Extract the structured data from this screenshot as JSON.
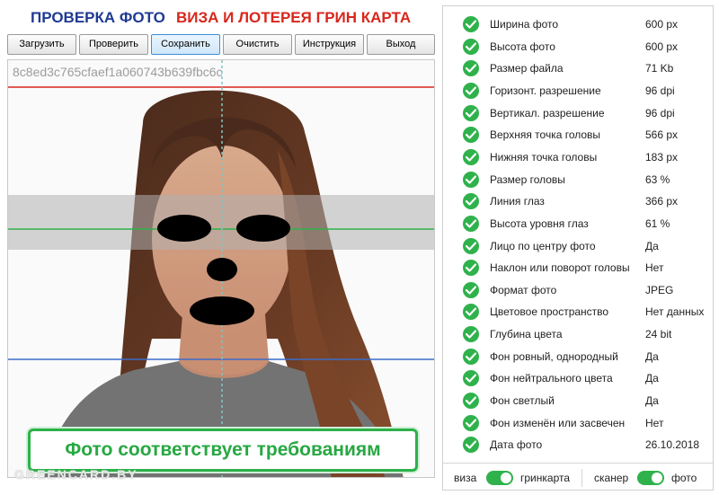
{
  "header": {
    "title_left": "ПРОВЕРКА ФОТО",
    "title_right": "ВИЗА И ЛОТЕРЕЯ ГРИН КАРТА",
    "title_left_color": "#1f3a93",
    "title_right_color": "#d9261c"
  },
  "toolbar": {
    "buttons": [
      "Загрузить",
      "Проверить",
      "Сохранить",
      "Очистить",
      "Инструкция",
      "Выход"
    ],
    "active": "Сохранить"
  },
  "photo": {
    "hash": "8c8ed3c765cfaef1a060743b639fbc6c",
    "status_text": "Фото соответствует требованиям",
    "watermark": "GREENCARD.BY"
  },
  "checks": [
    {
      "label": "Ширина фото",
      "value": "600 px"
    },
    {
      "label": "Высота фото",
      "value": "600 px"
    },
    {
      "label": "Размер файла",
      "value": "71 Kb"
    },
    {
      "label": "Горизонт. разрешение",
      "value": "96 dpi"
    },
    {
      "label": "Вертикал. разрешение",
      "value": "96 dpi"
    },
    {
      "label": "Верхняя точка головы",
      "value": "566 px"
    },
    {
      "label": "Нижняя точка головы",
      "value": "183 px"
    },
    {
      "label": "Размер головы",
      "value": "63 %"
    },
    {
      "label": "Линия глаз",
      "value": "366 px"
    },
    {
      "label": "Высота уровня глаз",
      "value": "61 %"
    },
    {
      "label": "Лицо по центру фото",
      "value": "Да"
    },
    {
      "label": "Наклон или поворот головы",
      "value": "Нет"
    },
    {
      "label": "Формат фото",
      "value": "JPEG"
    },
    {
      "label": "Цветовое пространство",
      "value": "Нет данных"
    },
    {
      "label": "Глубина цвета",
      "value": "24 bit"
    },
    {
      "label": "Фон ровный, однородный",
      "value": "Да"
    },
    {
      "label": "Фон нейтрального цвета",
      "value": "Да"
    },
    {
      "label": "Фон светлый",
      "value": "Да"
    },
    {
      "label": "Фон изменён или засвечен",
      "value": "Нет"
    },
    {
      "label": "Дата фото",
      "value": "26.10.2018"
    }
  ],
  "footer": {
    "left_label_a": "виза",
    "left_label_b": "гринкарта",
    "right_label_a": "сканер",
    "right_label_b": "фото",
    "left_toggle_on": true,
    "right_toggle_on": true
  },
  "colors": {
    "check_green": "#2fb24b",
    "status_green": "#27a842",
    "line_top": "#d9261c",
    "line_eye": "#2fb24b",
    "line_bottom": "#3b6cc8",
    "center_line": "#7fc4c4"
  }
}
